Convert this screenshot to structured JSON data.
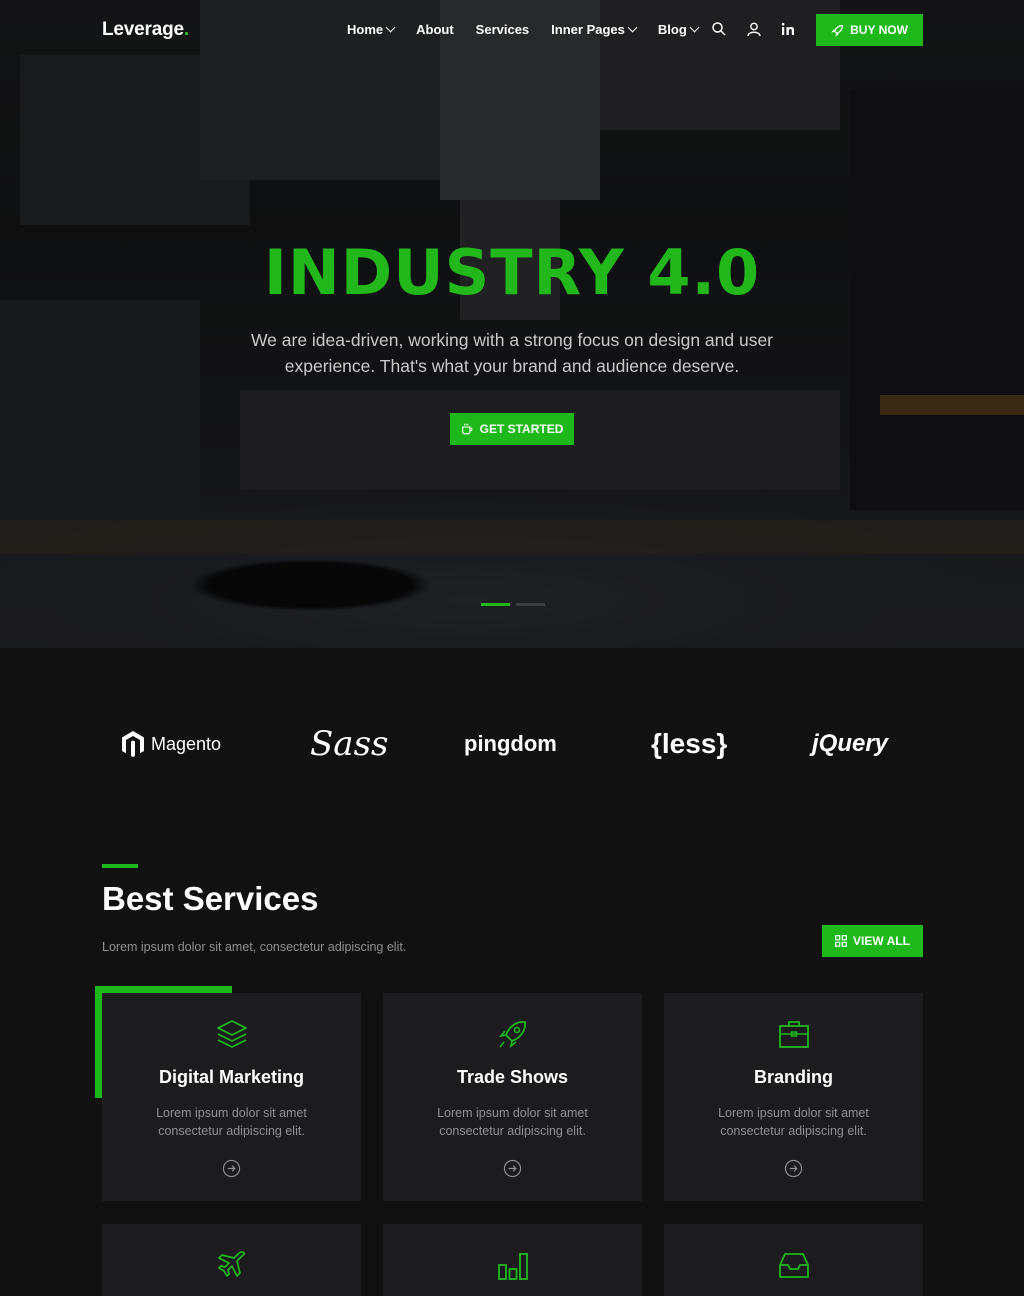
{
  "nav": {
    "logo_text": "Leverage",
    "logo_dot": ".",
    "items": [
      {
        "label": "Home",
        "has_dropdown": true
      },
      {
        "label": "About",
        "has_dropdown": false
      },
      {
        "label": "Services",
        "has_dropdown": false
      },
      {
        "label": "Inner Pages",
        "has_dropdown": true
      },
      {
        "label": "Blog",
        "has_dropdown": true
      }
    ],
    "icons": [
      "search-icon",
      "user-icon",
      "linkedin-icon"
    ],
    "buy_label": "BUY NOW"
  },
  "hero": {
    "title": "INDUSTRY 4.0",
    "subtitle": "We are idea-driven, working with a strong focus on design and user experience. That's what your brand and audience deserve.",
    "cta_label": "GET STARTED",
    "slide_count": 2,
    "active_slide": 1
  },
  "brands": [
    "Magento",
    "Sass",
    "pingdom",
    "{less}",
    "jQuery"
  ],
  "services": {
    "title": "Best Services",
    "subtitle": "Lorem ipsum dolor sit amet, consectetur adipiscing elit.",
    "view_all_label": "VIEW ALL",
    "cards": [
      {
        "icon": "layers-icon",
        "title": "Digital Marketing",
        "text": "Lorem ipsum dolor sit amet consectetur adipiscing elit."
      },
      {
        "icon": "rocket-icon",
        "title": "Trade Shows",
        "text": "Lorem ipsum dolor sit amet consectetur adipiscing elit."
      },
      {
        "icon": "briefcase-icon",
        "title": "Branding",
        "text": "Lorem ipsum dolor sit amet consectetur adipiscing elit."
      },
      {
        "icon": "airplane-icon",
        "title": "",
        "text": ""
      },
      {
        "icon": "bar-chart-icon",
        "title": "",
        "text": ""
      },
      {
        "icon": "inbox-icon",
        "title": "",
        "text": ""
      }
    ]
  },
  "colors": {
    "accent": "#1eb81a",
    "background": "#111112",
    "card": "#1c1c1e"
  }
}
